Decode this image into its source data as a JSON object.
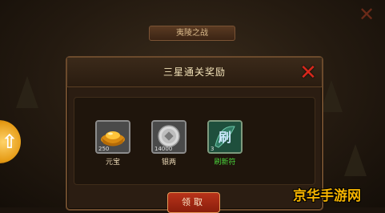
{
  "background": {
    "battle_title": "夷陵之战",
    "close_icon": "close-icon"
  },
  "dialog": {
    "title": "三星通关奖励",
    "close_icon": "close-icon",
    "rewards": [
      {
        "name": "元宝",
        "quantity": "250",
        "icon": "gold-ingot-icon"
      },
      {
        "name": "银两",
        "quantity": "14000",
        "icon": "silver-coin-icon"
      },
      {
        "name": "刷新符",
        "quantity": "3",
        "icon": "refresh-talisman-icon",
        "icon_text": "刷"
      }
    ],
    "claim_button": "领取"
  },
  "side_button": {
    "icon": "up-arrow-icon"
  },
  "watermark": "京华手游网",
  "colors": {
    "accent_red": "#d8281c",
    "reward_green": "#49d23b",
    "watermark_gold": "#f4b300"
  }
}
